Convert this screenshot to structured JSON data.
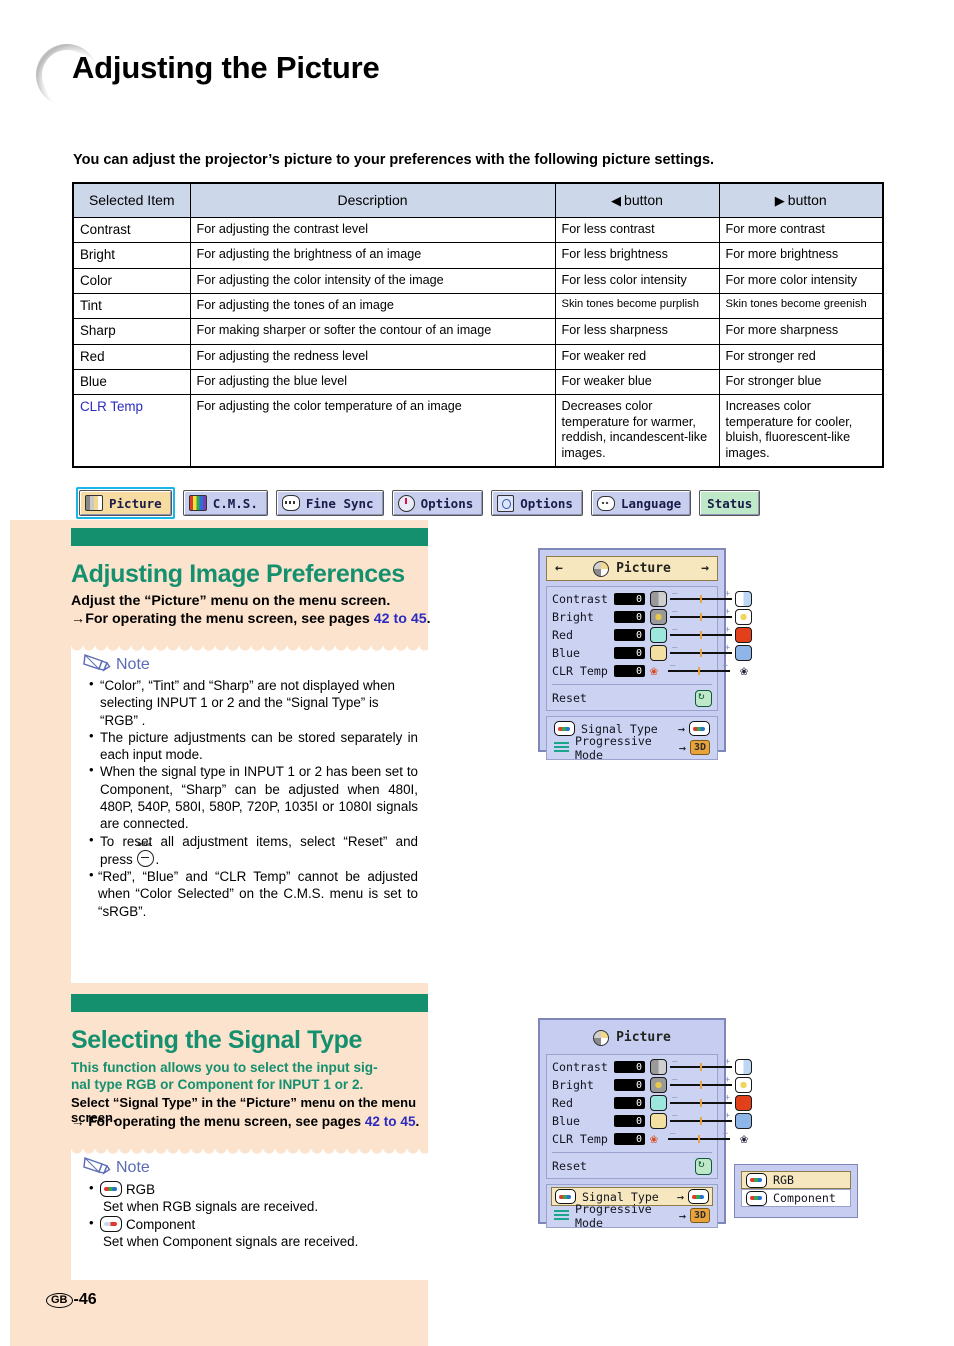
{
  "page": {
    "title": "Adjusting the Picture",
    "intro": "You can adjust the projector’s picture to your preferences with the following picture settings.",
    "footer_region": "GB",
    "footer_page": "-46"
  },
  "table": {
    "headers": [
      "Selected Item",
      "Description",
      "button",
      "button"
    ],
    "header_left_icon": "◀",
    "header_right_icon": "▶",
    "rows": [
      {
        "item": "Contrast",
        "desc": "For adjusting the contrast level",
        "left": "For less contrast",
        "right": "For more contrast"
      },
      {
        "item": "Bright",
        "desc": "For adjusting the brightness of an image",
        "left": "For less brightness",
        "right": "For more brightness"
      },
      {
        "item": "Color",
        "desc": "For adjusting the color intensity of the image",
        "left": "For less color intensity",
        "right": "For more color intensity"
      },
      {
        "item": "Tint",
        "desc": "For adjusting the tones of an image",
        "left": "Skin tones become purplish",
        "right": "Skin tones become greenish"
      },
      {
        "item": "Sharp",
        "desc": "For making sharper or softer the contour of an image",
        "left": "For less sharpness",
        "right": "For more sharpness"
      },
      {
        "item": "Red",
        "desc": "For adjusting the redness level",
        "left": "For weaker red",
        "right": "For stronger red"
      },
      {
        "item": "Blue",
        "desc": "For adjusting the blue level",
        "left": "For weaker blue",
        "right": "For stronger blue"
      },
      {
        "item": "CLR Temp",
        "desc": "For adjusting the color temperature of an image",
        "left": "Decreases color temperature for warmer, reddish, incandescent-like images.",
        "right": "Increases color temperature for cooler, bluish, fluorescent-like images."
      }
    ]
  },
  "tabbar": {
    "tabs": [
      {
        "label": "Picture",
        "icon": "picture-icon",
        "selected": true
      },
      {
        "label": "C.M.S.",
        "icon": "cms-icon",
        "selected": false
      },
      {
        "label": "Fine Sync",
        "icon": "fine-sync-icon",
        "selected": false
      },
      {
        "label": "Options",
        "icon": "options-clock-icon",
        "selected": false
      },
      {
        "label": "Options",
        "icon": "options-globe-icon",
        "selected": false
      },
      {
        "label": "Language",
        "icon": "language-icon",
        "selected": false
      },
      {
        "label": "Status",
        "icon": "",
        "selected": false
      }
    ]
  },
  "section1": {
    "heading": "Adjusting Image Preferences",
    "sub1": "Adjust the “Picture” menu on the menu screen.",
    "sub2_arrow": "→",
    "sub2_pre": "For operating the menu screen, see pages ",
    "sub2_pages": "42 to 45",
    "sub2_post": ".",
    "note_label": "Note",
    "notes": [
      "“Color”, “Tint” and “Sharp” are not displayed when selecting INPUT 1 or 2 and the “Signal Type” is “RGB” .",
      "The picture adjustments can be stored separately in each input mode.",
      "When the signal type in INPUT 1 or 2 has been set to Component, “Sharp” can be adjusted when 480I, 480P, 540P, 580I, 580P, 720P, 1035I or 1080I signals are connected.",
      "To reset all adjustment items, select “Reset” and press ",
      "“Red”, “Blue” and “CLR Temp” cannot be adjusted when “Color Selected” on the C.M.S. menu is set to “sRGB”."
    ],
    "note4_tail": "."
  },
  "section2": {
    "heading": "Selecting the Signal Type",
    "sub1": "This function allows you to select the input sig-",
    "sub2": "nal type RGB or Component for INPUT 1 or 2.",
    "sub3": "Select “Signal Type” in the “Picture” menu on the menu screen.",
    "sub4_arrow": "→",
    "sub4_pre": "For operating the menu screen, see pages ",
    "sub4_pages": "42 to 45",
    "sub4_post": ".",
    "note_label": "Note",
    "notes": [
      {
        "chip": "rgb",
        "title": "RGB",
        "body": "Set when RGB signals are received."
      },
      {
        "chip": "component",
        "title": "Component",
        "body": "Set when Component signals are received."
      }
    ]
  },
  "osd1": {
    "title": "Picture",
    "arrow_left": "←",
    "arrow_right": "→",
    "sliders": [
      {
        "label": "Contrast",
        "value": "0"
      },
      {
        "label": "Bright",
        "value": "0"
      },
      {
        "label": "Red",
        "value": "0"
      },
      {
        "label": "Blue",
        "value": "0"
      },
      {
        "label": "CLR Temp",
        "value": "0"
      }
    ],
    "slider_minus": "–",
    "slider_plus": "+",
    "reset_label": "Reset",
    "items": [
      {
        "label": "Signal Type",
        "arrow": "→",
        "badge": "signal-chip",
        "highlighted": false
      },
      {
        "label": "Progressive Mode",
        "arrow": "→",
        "badge": "3D",
        "highlighted": false
      }
    ]
  },
  "osd2": {
    "title": "Picture",
    "sliders": [
      {
        "label": "Contrast",
        "value": "0"
      },
      {
        "label": "Bright",
        "value": "0"
      },
      {
        "label": "Red",
        "value": "0"
      },
      {
        "label": "Blue",
        "value": "0"
      },
      {
        "label": "CLR Temp",
        "value": "0"
      }
    ],
    "slider_minus": "–",
    "slider_plus": "+",
    "reset_label": "Reset",
    "items": [
      {
        "label": "Signal Type",
        "arrow": "→",
        "badge": "signal-chip",
        "highlighted": true
      },
      {
        "label": "Progressive Mode",
        "arrow": "→",
        "badge": "3D",
        "highlighted": false
      }
    ]
  },
  "submenu": {
    "items": [
      {
        "label": "RGB",
        "highlighted": true
      },
      {
        "label": "Component",
        "highlighted": false
      }
    ]
  },
  "colors": {
    "green_accent": "#15906f",
    "beige_panel": "#fce3cd",
    "table_header": "#cdd7ea",
    "link_blue": "#2b2bc0",
    "osd_bg": "#c6cdf0",
    "osd_highlight": "#f7e7bf"
  }
}
